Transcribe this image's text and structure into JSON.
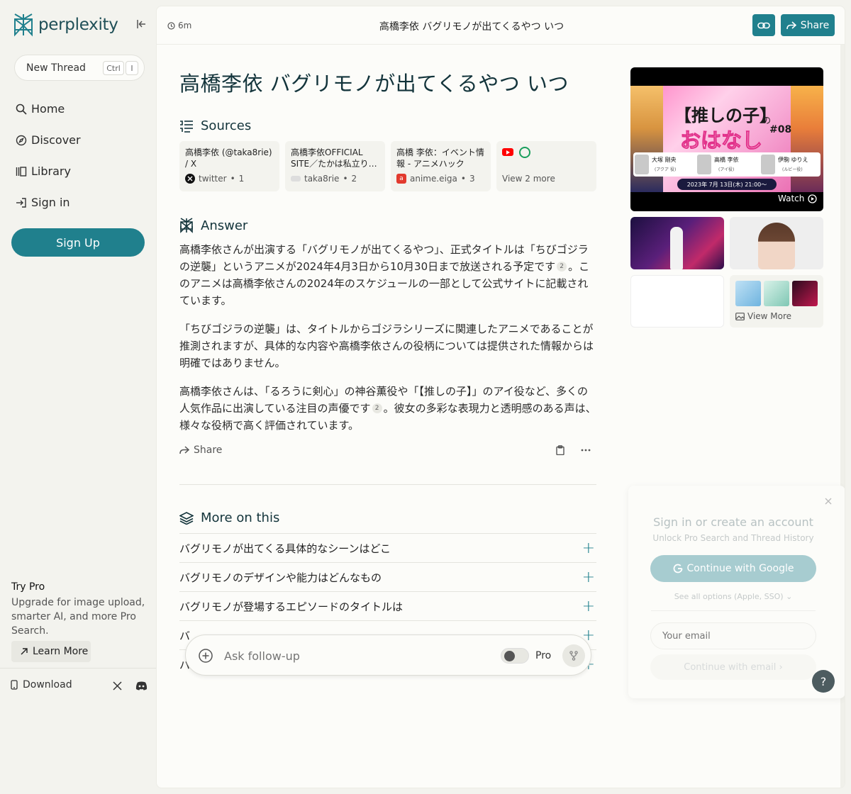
{
  "brand": {
    "name": "perplexity",
    "accent": "#20808d"
  },
  "sidebar": {
    "new_thread": "New Thread",
    "shortcut_ctrl": "Ctrl",
    "shortcut_key": "I",
    "nav": [
      {
        "label": "Home",
        "icon": "search-icon"
      },
      {
        "label": "Discover",
        "icon": "compass-icon"
      },
      {
        "label": "Library",
        "icon": "library-icon"
      },
      {
        "label": "Sign in",
        "icon": "sign-in-icon"
      }
    ],
    "signup": "Sign Up",
    "trypro_title": "Try Pro",
    "trypro_desc": "Upgrade for image upload, smarter AI, and more Pro Search.",
    "learn_more": "Learn More",
    "download": "Download"
  },
  "topbar": {
    "time": "6m",
    "title": "高橋李依 バグリモノが出てくるやつ いつ",
    "share": "Share"
  },
  "thread": {
    "title": "高橋李依 バグリモノが出てくるやつ いつ",
    "sources_label": "Sources",
    "sources": [
      {
        "title": "高橋李依 (@taka8rie) / X",
        "site": "twitter",
        "num": "1"
      },
      {
        "title": "高橋李依OFFICIAL SITE／たかは私立り…",
        "site": "taka8rie",
        "num": "2"
      },
      {
        "title": "高橋 李依：イベント情報 - アニメハック",
        "site": "anime.eiga",
        "num": "3"
      }
    ],
    "view_more_sources": "View 2 more",
    "answer_label": "Answer",
    "para1a": "高橋李依さんが出演する「バグリモノが出てくるやつ」、正式タイトルは「ちびゴジラの逆襲」というアニメが2024年4月3日から10月30日まで放送される予定です",
    "para1_cite": "2",
    "para1b": "。このアニメは高橋李依さんの2024年のスケジュールの一部として公式サイトに記載されています。",
    "para2": "「ちびゴジラの逆襲」は、タイトルからゴジラシリーズに関連したアニメであることが推測されますが、具体的な内容や高橋李依さんの役柄については提供された情報からは明確ではありません。",
    "para3a": "高橋李依さんは、「るろうに剣心」の神谷薫役や「【推しの子】」のアイ役など、多くの人気作品に出演している注目の声優です",
    "para3_cite": "2",
    "para3b": "。彼女の多彩な表現力と透明感のある声は、様々な役柄で高く評価されています。",
    "share_action": "Share",
    "more_label": "More on this",
    "more_items": [
      "バグリモノが出てくる具体的なシーンはどこ",
      "バグリモノのデザインや能力はどんなもの",
      "バグリモノが登場するエピソードのタイトルは",
      "バ",
      "バ"
    ]
  },
  "media": {
    "video_title_a": "【推しの子】",
    "video_title_no": "の",
    "video_title_b": "おはなし",
    "video_ep": "#08",
    "cast": [
      {
        "name": "大塚 剛央",
        "role": "(アクア 役)"
      },
      {
        "name": "高橋 李依",
        "role": "(アイ役)"
      },
      {
        "name": "伊駒 ゆりえ",
        "role": "(ルビー役)"
      }
    ],
    "video_date": "2023年 7月 13日(木) 21:00～",
    "watch": "Watch",
    "view_more": "View More"
  },
  "followup": {
    "placeholder": "Ask follow-up",
    "pro": "Pro"
  },
  "signin_card": {
    "title": "Sign in or create an account",
    "subtitle": "Unlock Pro Search and Thread History",
    "google": "Continue with Google",
    "see_all": "See all options (Apple, SSO)",
    "email_placeholder": "Your email",
    "continue_email": "Continue with email"
  },
  "help": "?"
}
